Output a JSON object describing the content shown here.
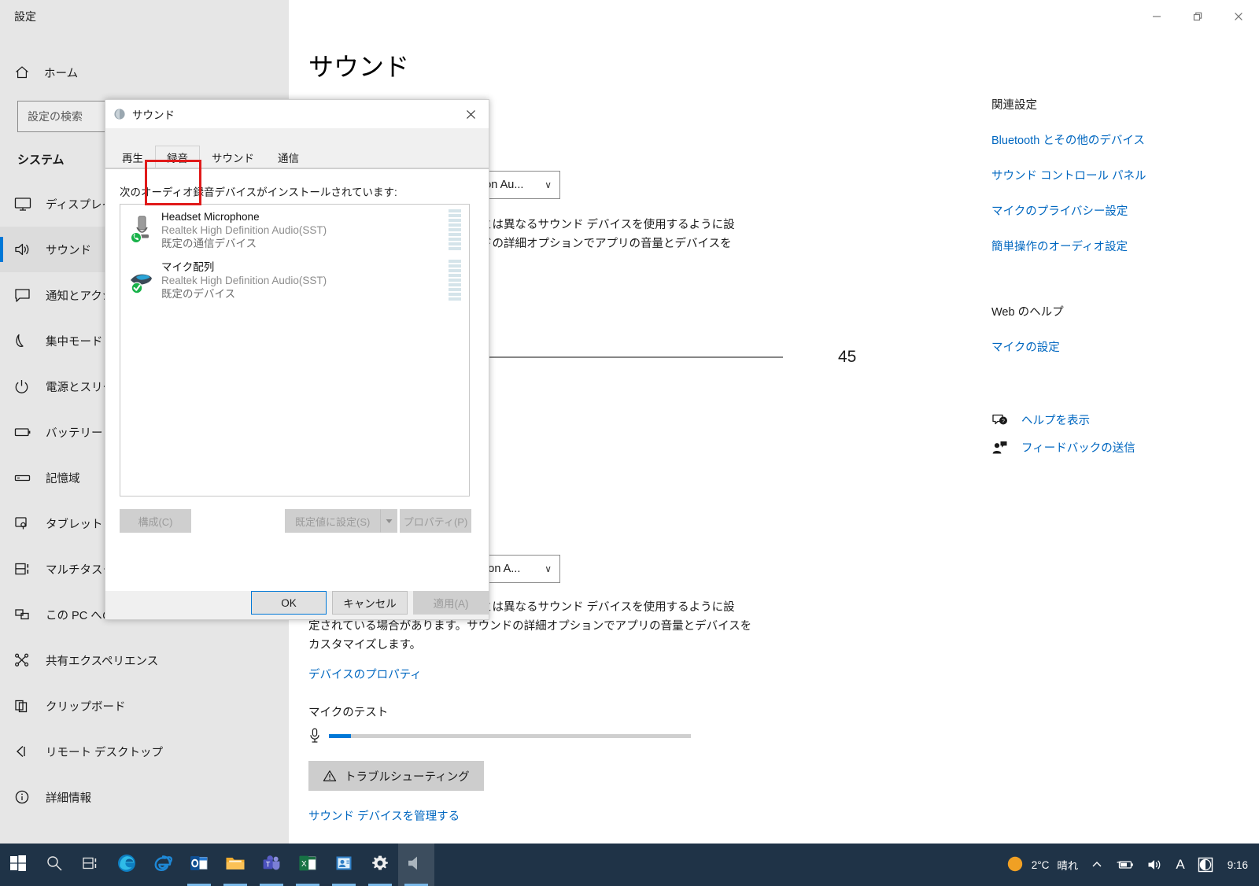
{
  "window": {
    "app_title": "設定",
    "minimize_label": "最小化",
    "maximize_label": "最大化",
    "close_label": "閉じる"
  },
  "sidebar": {
    "home_label": "ホーム",
    "search_placeholder": "設定の検索",
    "section_title": "システム",
    "items": [
      {
        "label": "ディスプレイ",
        "icon": "monitor-icon",
        "selected": false
      },
      {
        "label": "サウンド",
        "icon": "speaker-icon",
        "selected": true
      },
      {
        "label": "通知とアクション",
        "icon": "notification-icon",
        "selected": false
      },
      {
        "label": "集中モード",
        "icon": "moon-icon",
        "selected": false
      },
      {
        "label": "電源とスリープ",
        "icon": "power-icon",
        "selected": false
      },
      {
        "label": "バッテリー",
        "icon": "battery-icon",
        "selected": false
      },
      {
        "label": "記憶域",
        "icon": "storage-icon",
        "selected": false
      },
      {
        "label": "タブレット",
        "icon": "tablet-icon",
        "selected": false
      },
      {
        "label": "マルチタスク",
        "icon": "multitask-icon",
        "selected": false
      },
      {
        "label": "この PC へのプロジェクション",
        "icon": "projection-icon",
        "selected": false
      },
      {
        "label": "共有エクスペリエンス",
        "icon": "share-icon",
        "selected": false
      },
      {
        "label": "クリップボード",
        "icon": "clipboard-icon",
        "selected": false
      },
      {
        "label": "リモート デスクトップ",
        "icon": "remote-desktop-icon",
        "selected": false
      },
      {
        "label": "詳細情報",
        "icon": "info-icon",
        "selected": false
      }
    ]
  },
  "main": {
    "page_title": "サウンド",
    "output_device_value": "ion Au...",
    "output_desc_line1": "とは異なるサウンド デバイスを使用するように設",
    "output_desc_line2": "ドの詳細オプションでアプリの音量とデバイスを",
    "volume_value": "45",
    "input_device_value": "tion A...",
    "input_desc_line1": "とは異なるサウンド デバイスを使用するように設",
    "input_desc_line2": "定されている場合があります。サウンドの詳細オプションでアプリの音量とデバイスを",
    "input_desc_line3": "カスタマイズします。",
    "device_properties_link": "デバイスのプロパティ",
    "mic_test_label": "マイクのテスト",
    "mic_level_percent": 6,
    "troubleshoot_label": "トラブルシューティング",
    "manage_devices_link": "サウンド デバイスを管理する"
  },
  "rail": {
    "related_settings_heading": "関連設定",
    "related_links": [
      "Bluetooth とその他のデバイス",
      "サウンド コントロール パネル",
      "マイクのプライバシー設定",
      "簡単操作のオーディオ設定"
    ],
    "web_help_heading": "Web のヘルプ",
    "web_help_links": [
      "マイクの設定"
    ],
    "support_links": [
      {
        "label": "ヘルプを表示",
        "icon": "help-chat-icon"
      },
      {
        "label": "フィードバックの送信",
        "icon": "feedback-person-icon"
      }
    ]
  },
  "dialog": {
    "title": "サウンド",
    "close_label": "閉じる",
    "tabs": [
      {
        "label": "再生",
        "active": false
      },
      {
        "label": "録音",
        "active": true
      },
      {
        "label": "サウンド",
        "active": false
      },
      {
        "label": "通信",
        "active": false
      }
    ],
    "panel_label": "次のオーディオ録音デバイスがインストールされています:",
    "devices": [
      {
        "name": "Headset Microphone",
        "driver": "Realtek High Definition Audio(SST)",
        "status": "既定の通信デバイス",
        "icon": "microphone-device-icon",
        "badge": "green-phone-badge",
        "vu_segments": 9
      },
      {
        "name": "マイク配列",
        "driver": "Realtek High Definition Audio(SST)",
        "status": "既定のデバイス",
        "icon": "mic-array-device-icon",
        "badge": "green-check-badge",
        "vu_segments": 9
      }
    ],
    "buttons": {
      "configure": "構成(C)",
      "set_default": "既定値に設定(S)",
      "properties": "プロパティ(P)",
      "ok": "OK",
      "cancel": "キャンセル",
      "apply": "適用(A)"
    }
  },
  "taskbar": {
    "items": [
      {
        "name": "start-button",
        "icon": "windows-logo-icon",
        "running": false,
        "active": false
      },
      {
        "name": "search-button",
        "icon": "search-icon",
        "running": false,
        "active": false
      },
      {
        "name": "task-view-button",
        "icon": "task-view-icon",
        "running": false,
        "active": false
      },
      {
        "name": "edge-chromium-button",
        "icon": "edge-icon",
        "running": false,
        "active": false
      },
      {
        "name": "internet-explorer-button",
        "icon": "ie-icon",
        "running": false,
        "active": false
      },
      {
        "name": "outlook-button",
        "icon": "outlook-icon",
        "running": true,
        "active": false
      },
      {
        "name": "file-explorer-button",
        "icon": "folder-icon",
        "running": true,
        "active": false
      },
      {
        "name": "teams-button",
        "icon": "teams-icon",
        "running": true,
        "active": false
      },
      {
        "name": "excel-button",
        "icon": "excel-icon",
        "running": true,
        "active": false
      },
      {
        "name": "contacts-button",
        "icon": "contacts-icon",
        "running": true,
        "active": false
      },
      {
        "name": "settings-button",
        "icon": "gear-icon",
        "running": true,
        "active": false
      },
      {
        "name": "sound-control-button",
        "icon": "speaker-icon",
        "running": true,
        "active": true
      }
    ],
    "tray": {
      "weather_temp": "2°C",
      "weather_condition": "晴れ",
      "show_hidden_label": "隠れているインジケーターを表示します",
      "battery_label": "バッテリー",
      "volume_label": "スピーカー",
      "ime_label": "A",
      "night_light_label": "夜間モード",
      "clock": "9:16"
    }
  },
  "colors": {
    "accent": "#0078d7",
    "link": "#0067c0",
    "sidebar_bg": "#e6e6e6",
    "taskbar_bg": "#1f3347",
    "highlight_red": "#e01a1a"
  }
}
